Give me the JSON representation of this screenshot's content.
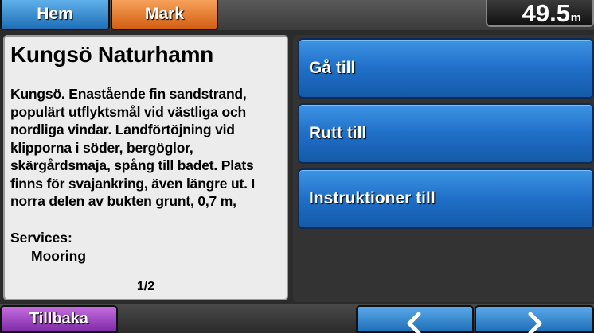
{
  "header": {
    "home_label": "Hem",
    "mark_label": "Mark",
    "depth_value": "49.5",
    "depth_unit": "m"
  },
  "poi": {
    "title": "Kungsö Naturhamn",
    "description": "Kungsö. Enastående fin sandstrand, populärt utflyktsmål vid västliga och nordliga vindar. Landförtöjning vid klipporna i söder, bergöglor, skärgårdsmaja, spång till badet. Plats finns för svajankring, även längre ut. I norra delen av bukten grunt, 0,7 m,",
    "services_label": "Services:",
    "services": [
      "Mooring"
    ],
    "page_indicator": "1/2"
  },
  "actions": {
    "go_to": "Gå till",
    "route_to": "Rutt till",
    "directions_to": "Instruktioner till"
  },
  "footer": {
    "back_label": "Tillbaka",
    "prev_icon": "chevron-left-icon",
    "next_icon": "chevron-right-icon"
  },
  "colors": {
    "home_tab": "#2f86d0",
    "mark_tab": "#e87a2c",
    "action_button": "#1f6fc8",
    "back_button": "#9c45c4",
    "panel_bg": "#ececec"
  }
}
